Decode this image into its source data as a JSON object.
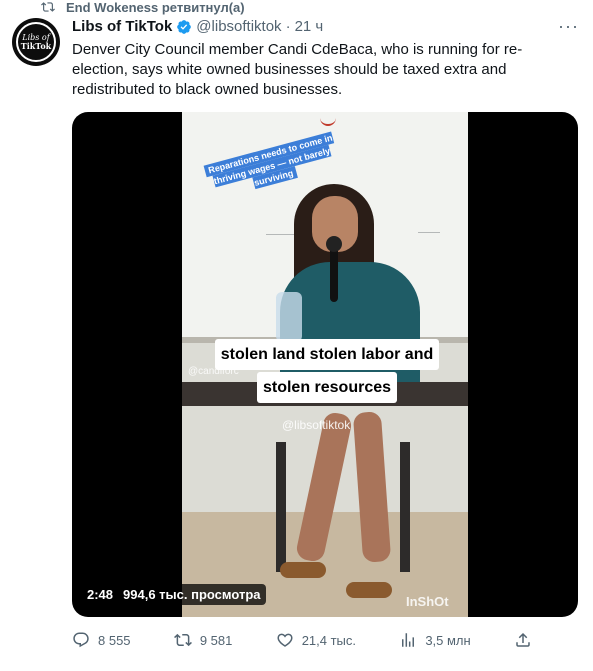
{
  "retweet": {
    "text": "End Wokeness ретвитнул(а)"
  },
  "tweet": {
    "author_name": "Libs of TikTok",
    "author_handle": "@libsoftiktok",
    "separator": "·",
    "time": "21 ч",
    "text": "Denver City Council member Candi CdeBaca, who is running for re-election, says white owned businesses should be taxed extra and redistributed to black owned businesses.",
    "avatar": {
      "line1": "Libs of",
      "line2": "TikTok"
    }
  },
  "media": {
    "sticker": "Reparations needs to come in thriving wages — not barely surviving",
    "caption_line1": "stolen land stolen labor and",
    "caption_line2": "stolen resources",
    "credit_left": "@candiforc",
    "watermark": "@libsoftiktok",
    "inshot": "InShOt",
    "duration": "2:48",
    "views": "994,6 тыс. просмотра"
  },
  "actions": {
    "replies": "8 555",
    "retweets": "9 581",
    "likes": "21,4 тыс.",
    "views": "3,5 млн"
  },
  "colors": {
    "muted": "#536471",
    "verified": "#1d9bf0",
    "text": "#0f1419"
  }
}
